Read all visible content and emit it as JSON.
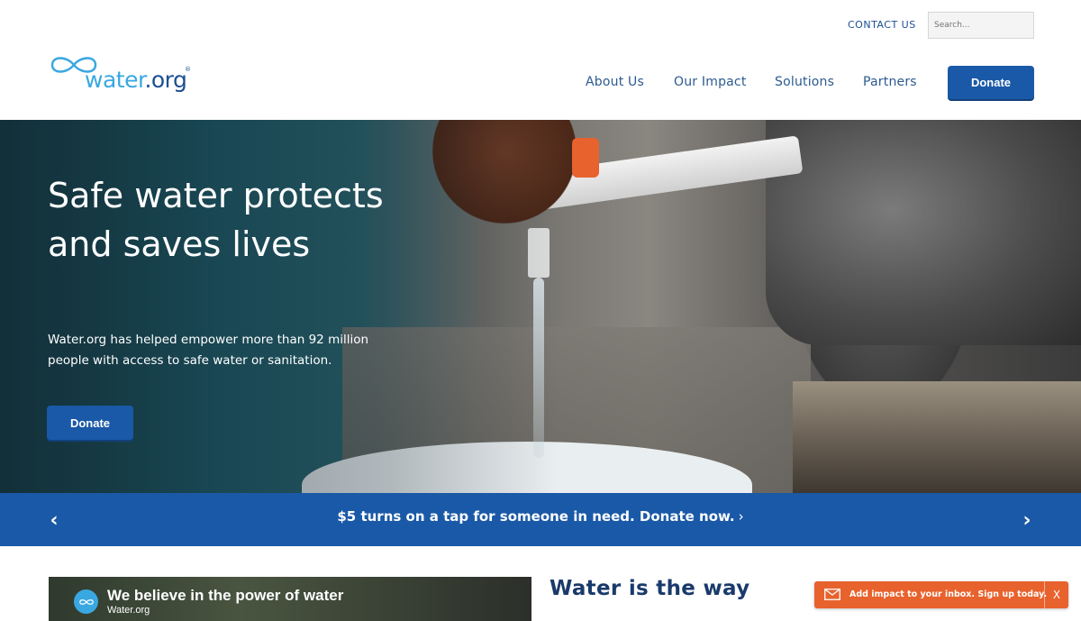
{
  "header": {
    "contact_label": "CONTACT US",
    "search_placeholder": "Search...",
    "logo": {
      "text_main": "water",
      "text_dot_org": ".org",
      "registered": "®"
    },
    "nav": [
      {
        "label": "About Us"
      },
      {
        "label": "Our Impact"
      },
      {
        "label": "Solutions"
      },
      {
        "label": "Partners"
      }
    ],
    "donate_label": "Donate"
  },
  "hero": {
    "title": "Safe water protects and saves lives",
    "subtitle": "Water.org has helped empower more than 92 million people with access to safe water or sanitation.",
    "donate_label": "Donate"
  },
  "banner": {
    "text": "$5 turns on a tap for someone in need. Donate now.",
    "chevron": "›",
    "prev_icon": "‹",
    "next_icon": "›"
  },
  "video": {
    "title": "We believe in the power of water",
    "channel": "Water.org"
  },
  "section": {
    "title": "Water is the way"
  },
  "signup": {
    "text": "Add impact to your inbox. Sign up today.",
    "close_label": "X"
  },
  "colors": {
    "primary_blue": "#1a59a7",
    "logo_light_blue": "#3aa8e0",
    "signup_orange": "#e8622d",
    "heading_navy": "#1a3a6b"
  }
}
